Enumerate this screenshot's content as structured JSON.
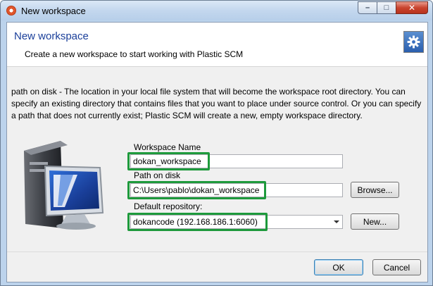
{
  "window": {
    "title": "New workspace",
    "controls": {
      "minimize": "–",
      "maximize": "□",
      "close": "✕"
    }
  },
  "header": {
    "title": "New workspace",
    "subtitle": "Create a new workspace to start working with Plastic SCM",
    "icon": "gear-icon"
  },
  "description": "path on disk - The location in your local file system that will become the workspace root directory. You can specify an existing directory that contains files that you want to place under source control. Or you can specify a path that does not currently exist; Plastic SCM will create a new, empty workspace directory.",
  "form": {
    "workspace_name": {
      "label": "Workspace Name",
      "value": "dokan_workspace"
    },
    "path_on_disk": {
      "label": "Path on disk",
      "value": "C:\\Users\\pablo\\dokan_workspace",
      "browse_label": "Browse..."
    },
    "default_repository": {
      "label": "Default repository:",
      "value": "dokancode (192.168.186.1:6060)",
      "new_label": "New..."
    }
  },
  "buttons": {
    "ok": "OK",
    "cancel": "Cancel"
  },
  "colors": {
    "highlight": "#1e9a3c",
    "header_title": "#1a3f9a"
  }
}
